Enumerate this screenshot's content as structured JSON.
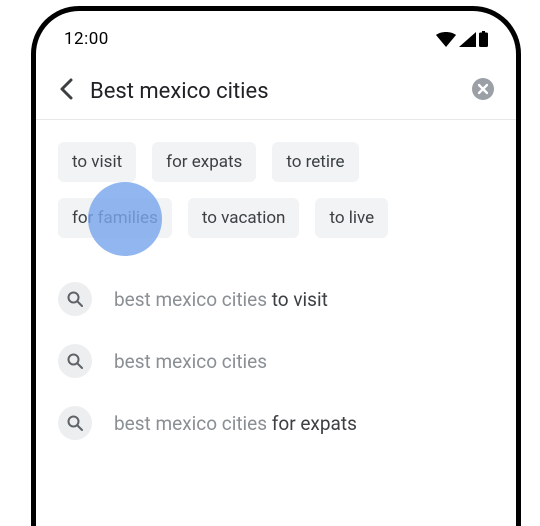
{
  "status": {
    "time": "12:00"
  },
  "search": {
    "query": "Best mexico cities"
  },
  "chips": {
    "row1": [
      {
        "label": "to visit"
      },
      {
        "label": "for expats"
      },
      {
        "label": "to retire"
      }
    ],
    "row2": [
      {
        "label": "for families"
      },
      {
        "label": "to vacation"
      },
      {
        "label": "to live"
      }
    ]
  },
  "suggestions": [
    {
      "prefix": "best mexico cities ",
      "emph": "to visit"
    },
    {
      "prefix": "best mexico cities",
      "emph": ""
    },
    {
      "prefix": "best mexico cities ",
      "emph": "for expats"
    }
  ]
}
